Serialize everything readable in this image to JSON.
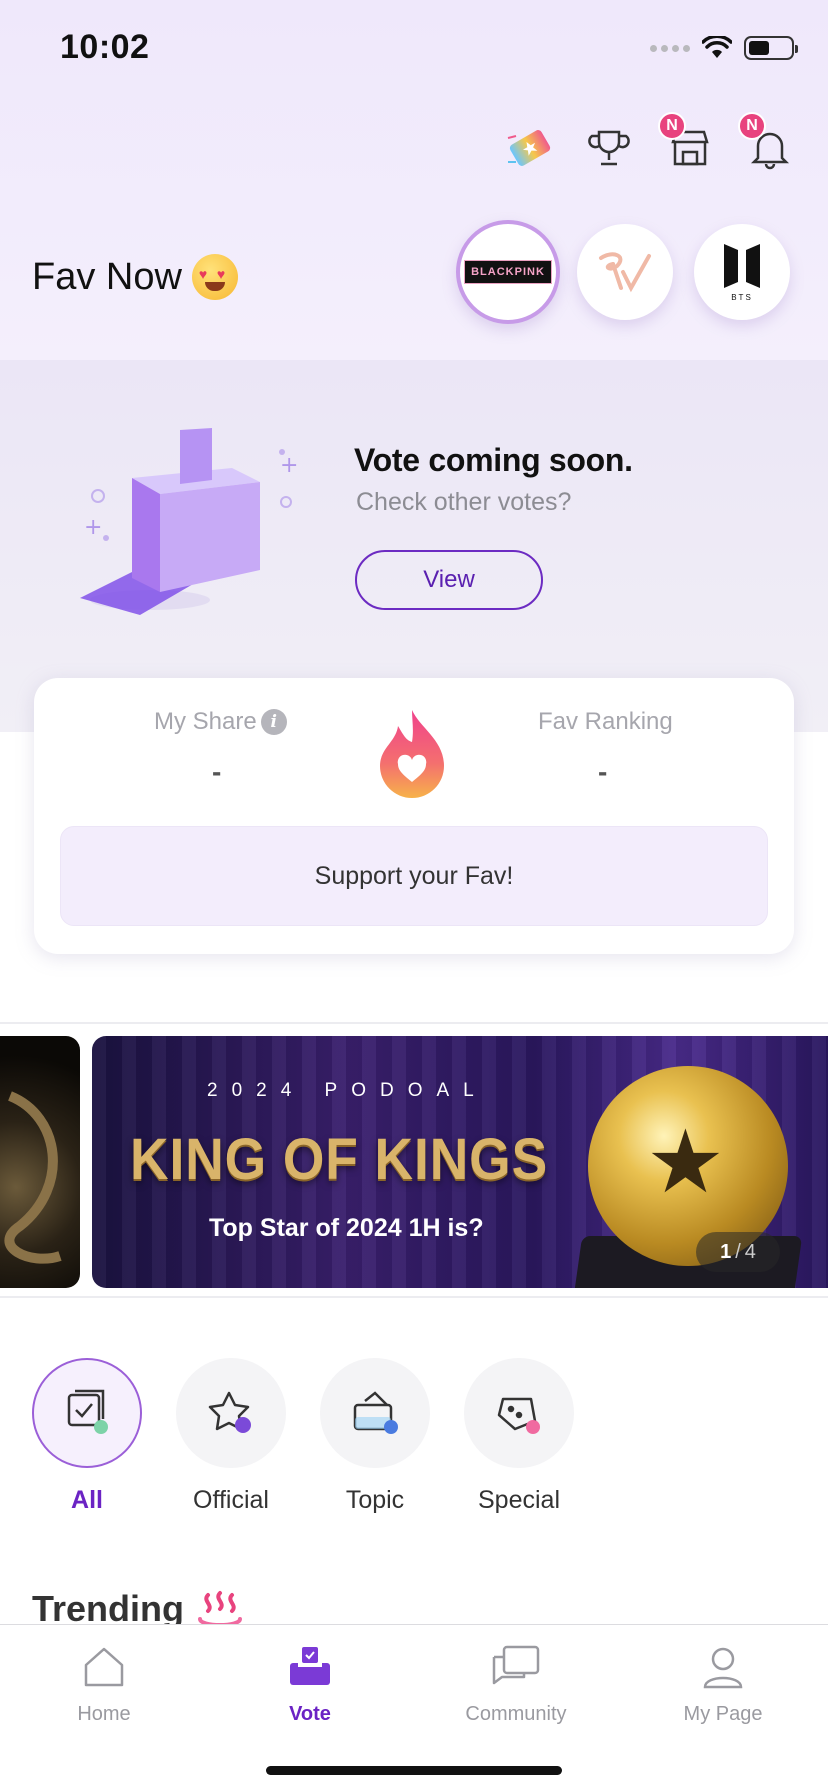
{
  "status_bar": {
    "time": "10:02"
  },
  "header": {
    "icons": [
      "ticket-icon",
      "trophy-icon",
      "shop-icon",
      "bell-icon"
    ],
    "shop_badge": "N",
    "bell_badge": "N"
  },
  "fav_now": {
    "title": "Fav Now",
    "emoji": "heart-eyes-emoji",
    "favorites": [
      {
        "label": "BLACKPINK",
        "selected": true
      },
      {
        "label": "Red Velvet logo",
        "selected": false
      },
      {
        "label": "BTS",
        "selected": false
      }
    ]
  },
  "vote_banner": {
    "title": "Vote coming soon.",
    "subtitle": "Check other votes?",
    "button": "View"
  },
  "stats": {
    "my_share_label": "My Share",
    "my_share_value": "-",
    "fav_ranking_label": "Fav Ranking",
    "fav_ranking_value": "-",
    "support_button": "Support your Fav!"
  },
  "promo_banner": {
    "year_line": "2024 PODOAL",
    "headline": "KING OF KINGS",
    "subline": "Top Star of 2024 1H is?",
    "page_current": "1",
    "page_separator": "/",
    "page_total": "4"
  },
  "categories": [
    {
      "label": "All",
      "active": true
    },
    {
      "label": "Official",
      "active": false
    },
    {
      "label": "Topic",
      "active": false
    },
    {
      "label": "Special",
      "active": false
    }
  ],
  "trending": {
    "title": "Trending"
  },
  "tabbar": [
    {
      "label": "Home",
      "active": false
    },
    {
      "label": "Vote",
      "active": true
    },
    {
      "label": "Community",
      "active": false
    },
    {
      "label": "My Page",
      "active": false
    }
  ],
  "colors": {
    "accent": "#6b23c4",
    "badge": "#e8437e",
    "header_bg": "#efe8fb"
  }
}
